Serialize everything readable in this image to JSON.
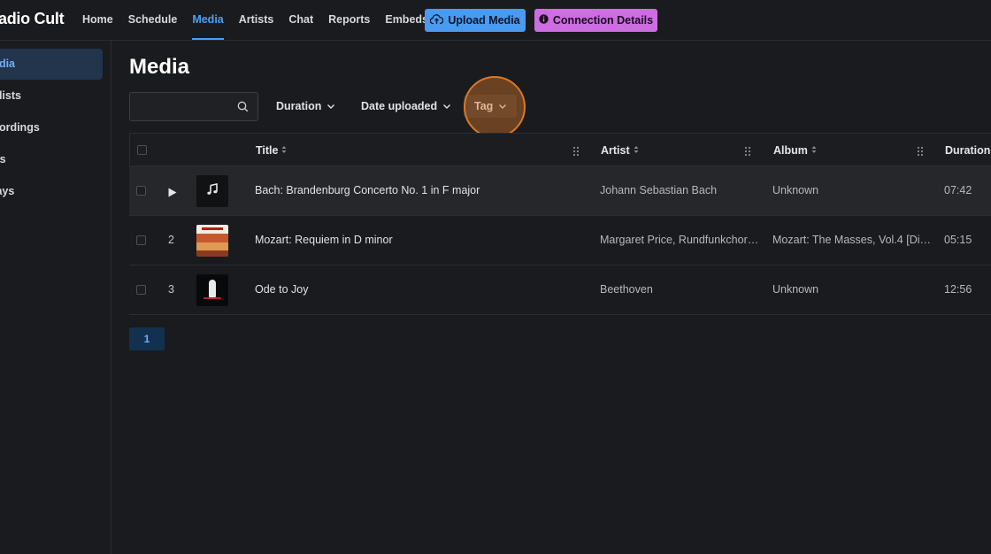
{
  "app": {
    "logo": "adio Cult"
  },
  "nav": {
    "items": [
      {
        "label": "Home"
      },
      {
        "label": "Schedule"
      },
      {
        "label": "Media",
        "active": true
      },
      {
        "label": "Artists"
      },
      {
        "label": "Chat"
      },
      {
        "label": "Reports"
      },
      {
        "label": "Embeds"
      }
    ],
    "upload_label": "Upload Media",
    "upload_icon": "cloud-upload-icon",
    "connection_label": "Connection Details",
    "connection_icon": "info-icon"
  },
  "sidebar": {
    "items": [
      {
        "label": "edia",
        "active": true
      },
      {
        "label": "ylists"
      },
      {
        "label": "cordings"
      },
      {
        "label": "gs"
      },
      {
        "label": "lays"
      }
    ]
  },
  "main": {
    "title": "Media",
    "search": {
      "value": "",
      "placeholder": "",
      "icon": "search-icon"
    },
    "filters": {
      "duration": "Duration",
      "date_uploaded": "Date uploaded",
      "tag": "Tag"
    },
    "table": {
      "headers": {
        "title": "Title",
        "artist": "Artist",
        "album": "Album",
        "duration": "Duration"
      },
      "rows": [
        {
          "num": "",
          "title": "Bach: Brandenburg Concerto No. 1 in F major",
          "artist": "Johann Sebastian Bach",
          "album": "Unknown",
          "duration": "07:42"
        },
        {
          "num": "2",
          "title": "Mozart: Requiem in D minor",
          "artist": "Margaret Price, Rundfunkchor…",
          "album": "Mozart: The Masses, Vol.4 [Dis…",
          "duration": "05:15"
        },
        {
          "num": "3",
          "title": "Ode to Joy",
          "artist": "Beethoven",
          "album": "Unknown",
          "duration": "12:56"
        }
      ]
    },
    "pagination": {
      "current": "1"
    }
  },
  "colors": {
    "accent": "#4d9ef5",
    "upload_button": "#4a9af0",
    "connection_button": "#cc6de0",
    "highlight": "#d9792a",
    "background": "#1a1b1e"
  }
}
